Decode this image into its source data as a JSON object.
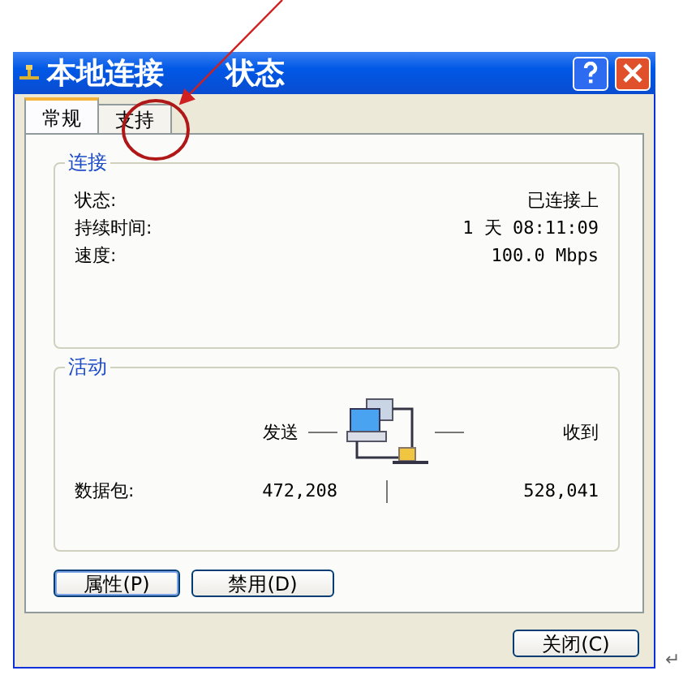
{
  "window": {
    "title": "本地连接 状态"
  },
  "tabs": [
    {
      "label": "常规",
      "selected": true
    },
    {
      "label": "支持",
      "selected": false
    }
  ],
  "connection": {
    "title": "连接",
    "rows": [
      {
        "label": "状态:",
        "value": "已连接上"
      },
      {
        "label": "持续时间:",
        "value": "1 天 08:11:09"
      },
      {
        "label": "速度:",
        "value": "100.0 Mbps"
      }
    ]
  },
  "activity": {
    "title": "活动",
    "sent_label": "发送",
    "received_label": "收到",
    "packets_label": "数据包:",
    "sent": "472,208",
    "received": "528,041"
  },
  "buttons": [
    {
      "label": "属性(P)",
      "default": true
    },
    {
      "label": "禁用(D)",
      "default": false
    }
  ],
  "close_button": "关闭(C)",
  "paragraph_mark": "↵"
}
